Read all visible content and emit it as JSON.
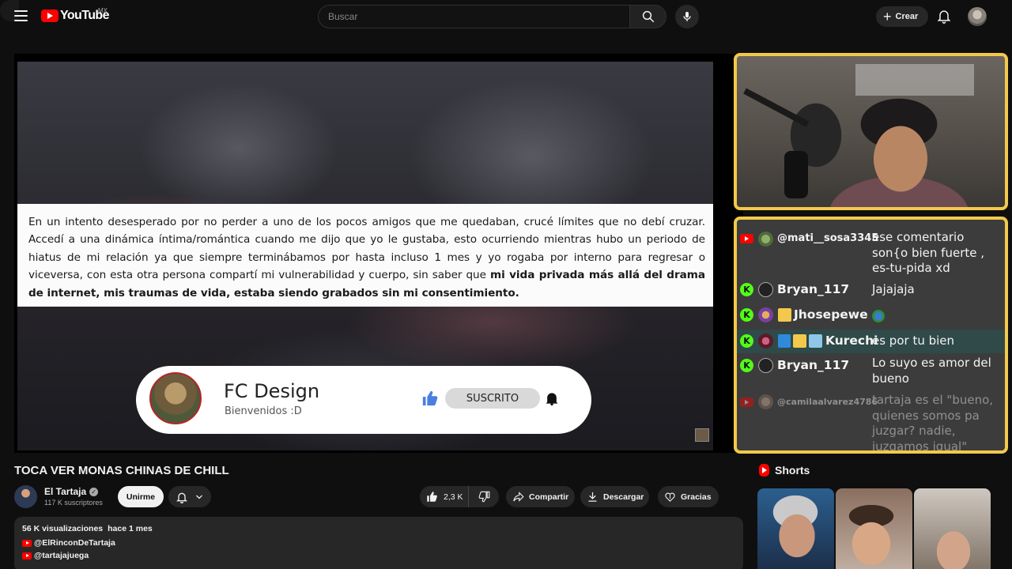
{
  "masthead": {
    "logo_text": "YouTube",
    "country": "MX",
    "search_placeholder": "Buscar",
    "create_label": "Crear"
  },
  "video_overlay": {
    "text_normal": "En un intento desesperado por no perder a uno de los pocos amigos que me quedaban, crucé límites que no debí cruzar. Accedí a una dinámica íntima/romántica cuando me dijo que yo le gustaba, esto ocurriendo mientras hubo un periodo de hiatus de mi relación ya que siempre terminábamos por hasta incluso 1 mes y yo rogaba por interno para regresar o viceversa, con esta otra persona compartí mi vulnerabilidad y cuerpo, sin saber que ",
    "text_bold": "mi vida privada más allá del drama de internet, mis traumas de vida, estaba siendo grabados sin mi consentimiento.",
    "subscribe_widget": {
      "name": "FC Design",
      "tagline": "Bienvenidos :D",
      "button": "SUSCRITO"
    }
  },
  "chat": {
    "messages": [
      {
        "platform": "youtube",
        "user": "@mati__sosa3345",
        "text": "ese comentario son{o bien fuerte , es-tu-pida xd"
      },
      {
        "platform": "kick",
        "user": "Bryan_117",
        "text": "Jajajaja"
      },
      {
        "platform": "kick",
        "user": "Jhosepewe",
        "text": ""
      },
      {
        "platform": "kick",
        "user": "Kurechi",
        "text": "es por tu bien"
      },
      {
        "platform": "kick",
        "user": "Bryan_117",
        "text": "Lo suyo es amor del bueno"
      },
      {
        "platform": "youtube",
        "user": "@camilaalvarez4786",
        "text": "tartaja es el \"bueno, quienes somos pa juzgar? nadie, juzgamos igual\""
      }
    ]
  },
  "video": {
    "title": "TOCA VER MONAS CHINAS DE CHILL",
    "channel_name": "El Tartaja",
    "subscribers": "117 K suscriptores",
    "join_label": "Unirme",
    "likes": "2,3 K",
    "share_label": "Compartir",
    "download_label": "Descargar",
    "thanks_label": "Gracias"
  },
  "description": {
    "views": "56 K visualizaciones",
    "date": "hace 1 mes",
    "links": [
      "@ElRinconDeTartaja",
      "@tartajajuega"
    ]
  },
  "shorts": {
    "heading": "Shorts"
  },
  "colors": {
    "brand_red": "#ff0000",
    "overlay_border": "#f3c94b",
    "kick_green": "#53fc18",
    "background": "#0f0f0f"
  }
}
